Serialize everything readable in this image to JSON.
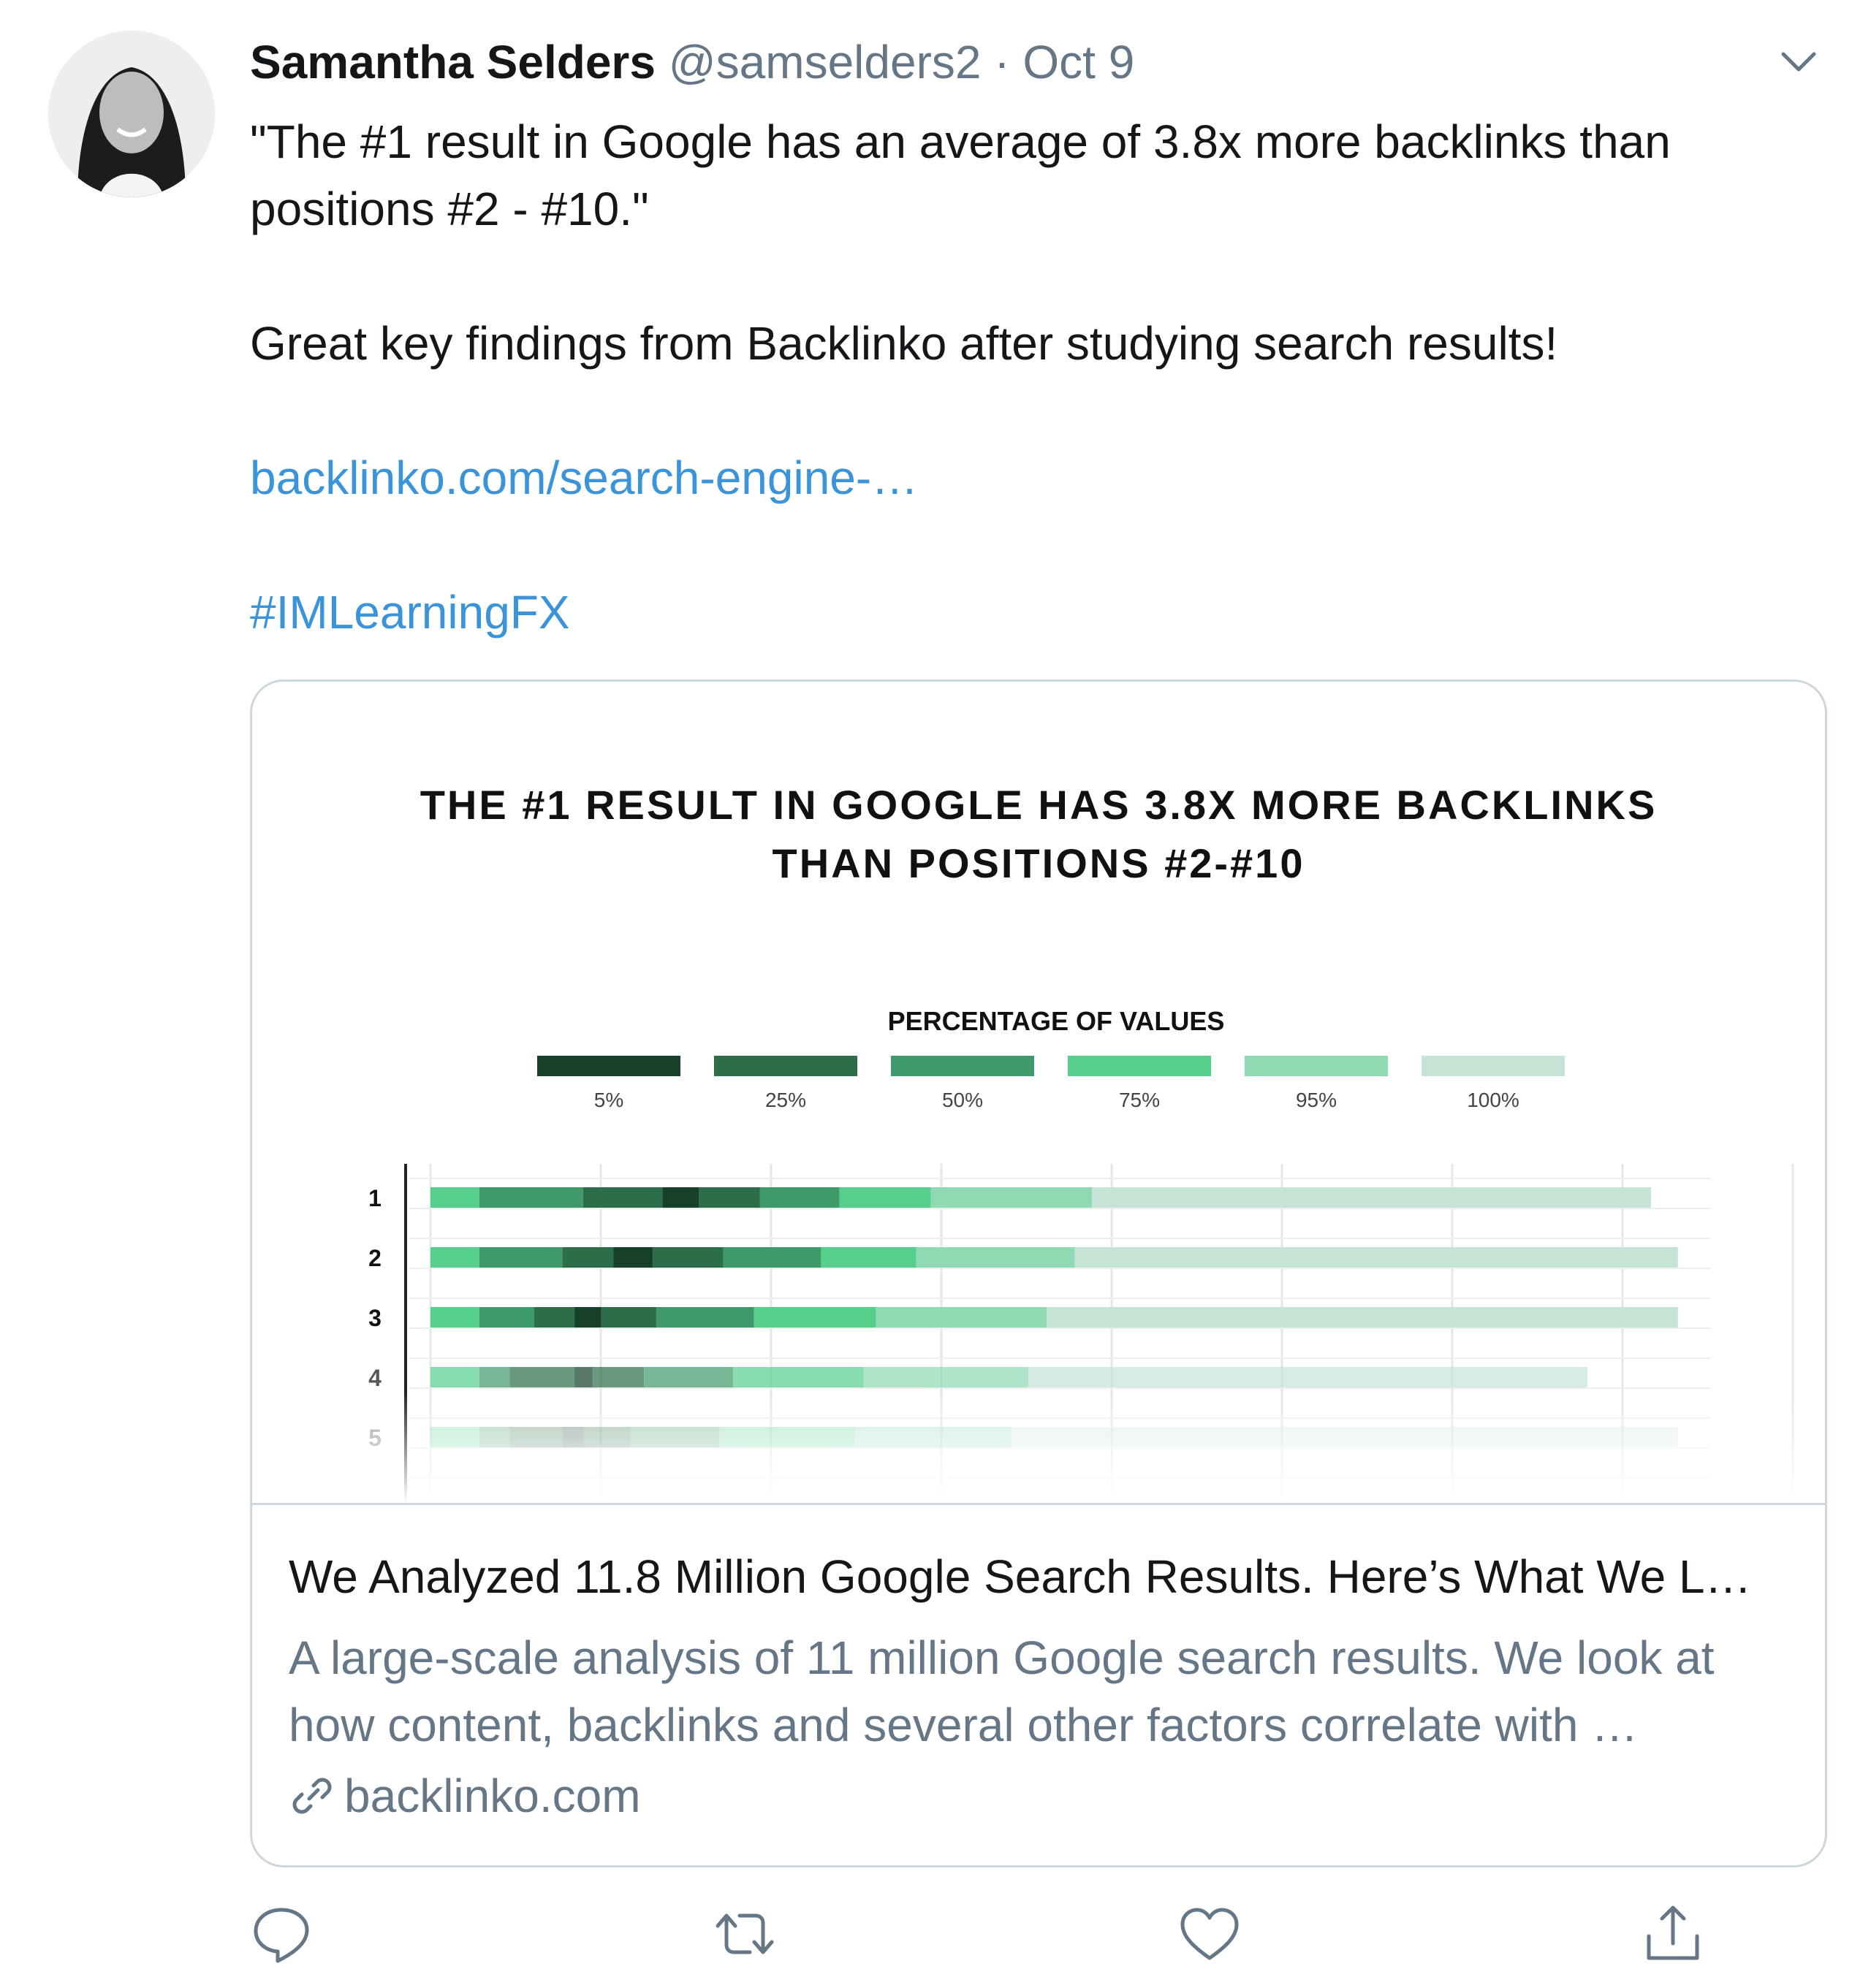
{
  "tweet": {
    "author_name": "Samantha Selders",
    "handle": "@samselders2",
    "separator": "·",
    "date": "Oct 9",
    "text_line1": "\"The #1 result in Google has an average of 3.8x more backlinks than",
    "text_line2": "positions #2 - #10.\"",
    "text_para2": "Great key findings from Backlinko after studying search results!",
    "link_text": "backlinko.com/search-engine-…",
    "hashtag": "#IMLearningFX"
  },
  "card": {
    "title": "We Analyzed 11.8 Million Google Search Results. Here’s What We L…",
    "description_line1": "A large-scale analysis of 11 million Google search results. We look at",
    "description_line2": "how content, backlinks and several other factors correlate with …",
    "domain": "backlinko.com"
  },
  "chart_data": {
    "type": "bar",
    "title": "THE #1 RESULT IN GOOGLE HAS 3.8X MORE BACKLINKS",
    "title_line2": "THAN POSITIONS #2-#10",
    "legend_title": "PERCENTAGE OF VALUES",
    "legend": [
      "5%",
      "25%",
      "50%",
      "75%",
      "95%",
      "100%"
    ],
    "legend_colors": [
      "#17402b",
      "#2b6e49",
      "#3f9a6a",
      "#56cf8d",
      "#8fd9b3",
      "#c6e4d6"
    ],
    "categories": [
      "1",
      "2",
      "3",
      "4",
      "5"
    ],
    "stacked_segments_end_fraction": [
      [
        0.04,
        0.125,
        0.19,
        0.22,
        0.27,
        0.335,
        0.41,
        0.542,
        1.0
      ],
      [
        0.04,
        0.108,
        0.15,
        0.182,
        0.24,
        0.32,
        0.398,
        0.528,
        1.022
      ],
      [
        0.04,
        0.085,
        0.118,
        0.14,
        0.185,
        0.265,
        0.365,
        0.505,
        1.022
      ],
      [
        0.04,
        0.065,
        0.118,
        0.133,
        0.175,
        0.248,
        0.355,
        0.49,
        0.948
      ],
      [
        0.04,
        0.065,
        0.108,
        0.126,
        0.164,
        0.237,
        0.348,
        0.476,
        1.022
      ]
    ],
    "segment_color_index": [
      3,
      2,
      1,
      0,
      1,
      2,
      3,
      4,
      5
    ],
    "row_opacity": [
      1.0,
      1.0,
      1.0,
      0.7,
      0.4
    ]
  },
  "actions": {
    "reply_icon": "reply-icon",
    "retweet_icon": "retweet-icon",
    "like_icon": "like-icon",
    "share_icon": "share-icon"
  }
}
